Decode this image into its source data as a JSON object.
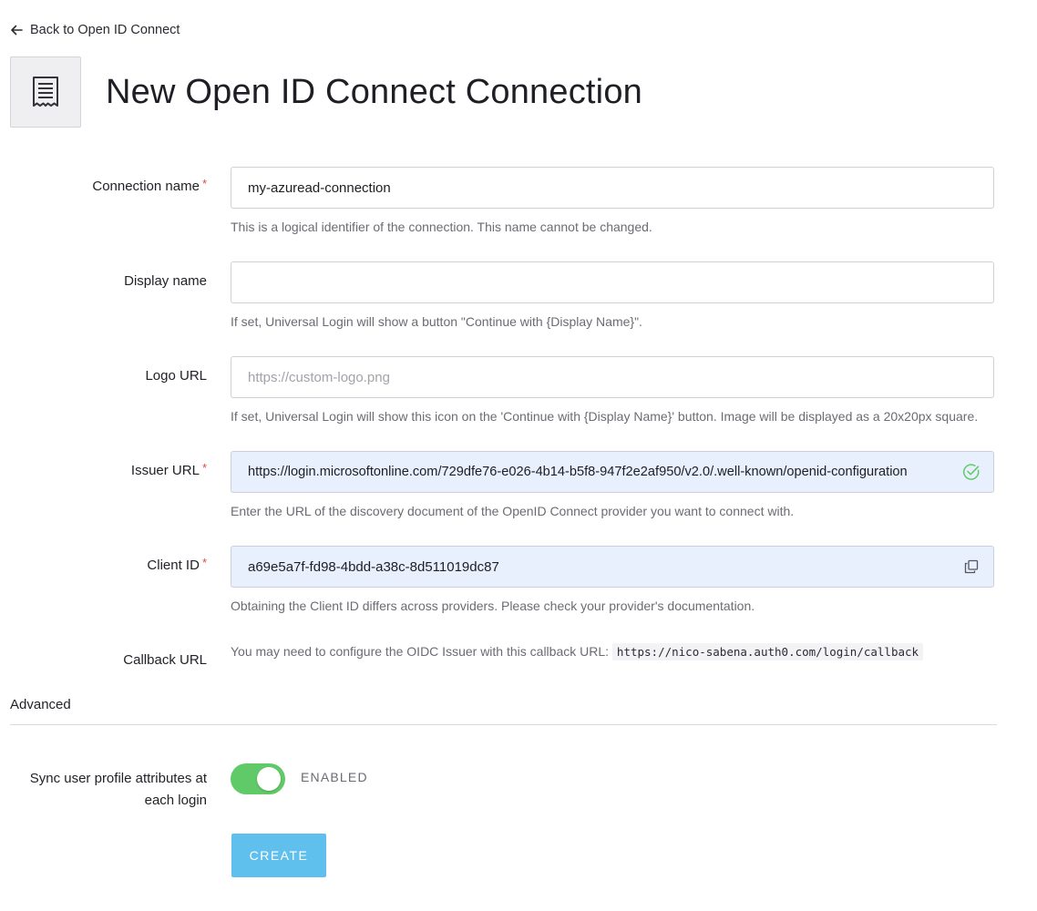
{
  "back_link": {
    "label": "Back to Open ID Connect"
  },
  "header": {
    "title": "New Open ID Connect Connection",
    "icon": "receipt-icon"
  },
  "form": {
    "connection_name": {
      "label": "Connection name",
      "required": "*",
      "value": "my-azuread-connection",
      "help": "This is a logical identifier of the connection. This name cannot be changed."
    },
    "display_name": {
      "label": "Display name",
      "value": "",
      "help": "If set, Universal Login will show a button \"Continue with {Display Name}\"."
    },
    "logo_url": {
      "label": "Logo URL",
      "value": "",
      "placeholder": "https://custom-logo.png",
      "help": "If set, Universal Login will show this icon on the 'Continue with {Display Name}' button. Image will be displayed as a 20x20px square."
    },
    "issuer_url": {
      "label": "Issuer URL",
      "required": "*",
      "value": "https://login.microsoftonline.com/729dfe76-e026-4b14-b5f8-947f2e2af950/v2.0/.well-known/openid-configuration",
      "help": "Enter the URL of the discovery document of the OpenID Connect provider you want to connect with.",
      "status_icon": "check-circle-icon",
      "status_color": "#5fca67"
    },
    "client_id": {
      "label": "Client ID",
      "required": "*",
      "value": "a69e5a7f-fd98-4bdd-a38c-8d511019dc87",
      "help": "Obtaining the Client ID differs across providers. Please check your provider's documentation.",
      "action_icon": "copy-icon"
    },
    "callback_url": {
      "label": "Callback URL",
      "help_prefix": "You may need to configure the OIDC Issuer with this callback URL:",
      "url": "https://nico-sabena.auth0.com/login/callback"
    }
  },
  "advanced": {
    "title": "Advanced",
    "sync_profile": {
      "label": "Sync user profile attributes at each login",
      "state": "ENABLED",
      "enabled": true,
      "toggle_color": "#5fca67"
    }
  },
  "actions": {
    "create_label": "CREATE",
    "create_color": "#5fc0ee"
  },
  "colors": {
    "required_mark": "#e04a3a",
    "autofill_background": "#e8f0fd"
  }
}
